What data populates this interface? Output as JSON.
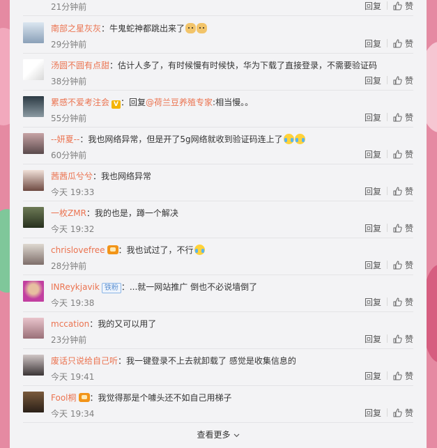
{
  "top_row": {
    "time": "21分钟前",
    "reply": "回复",
    "like": "赞"
  },
  "comments": [
    {
      "user": "南部之星灰灰",
      "text": "：牛鬼蛇神都跳出来了",
      "emojis": [
        "dog",
        "dog"
      ],
      "time": "29分钟前",
      "badge": "",
      "reply": "回复",
      "like": "赞"
    },
    {
      "user": "汤圆不圆有点甜",
      "text": "：估计人多了，有时候慢有时候快，华为下载了直接登录，不需要验证码",
      "emojis": [],
      "time": "38分钟前",
      "badge": "",
      "reply": "回复",
      "like": "赞"
    },
    {
      "user": "累感不爱考注会",
      "text_pre": "：回复",
      "mention": "@荷兰豆养殖专家",
      "text": ":相当慢。。",
      "emojis": [],
      "time": "55分钟前",
      "badge": "v",
      "reply": "回复",
      "like": "赞"
    },
    {
      "user": "--妍夏--",
      "text": "：我也网络异常，但是开了5g网络就收到验证码连上了",
      "emojis": [
        "tears",
        "tears"
      ],
      "time": "60分钟前",
      "badge": "",
      "reply": "回复",
      "like": "赞"
    },
    {
      "user": "茜茜瓜兮兮",
      "text": "：我也网络异常",
      "emojis": [],
      "time": "今天 19:33",
      "badge": "",
      "reply": "回复",
      "like": "赞"
    },
    {
      "user": "一枚ZMR",
      "text": "：我的也是，蹲一个解决",
      "emojis": [],
      "time": "今天 19:32",
      "badge": "",
      "reply": "回复",
      "like": "赞"
    },
    {
      "user": "chrislovefree",
      "text": "：我也试过了，不行",
      "emojis": [
        "tears"
      ],
      "time": "28分钟前",
      "badge": "vip",
      "reply": "回复",
      "like": "赞"
    },
    {
      "user": "INReykjavik",
      "text": "：...就一网站推广 倒也不必说墙倒了",
      "emojis": [],
      "time": "今天 19:38",
      "badge": "fan",
      "badge_text": "铁粉",
      "reply": "回复",
      "like": "赞"
    },
    {
      "user": "mccation",
      "text": "：我的又可以用了",
      "emojis": [],
      "time": "23分钟前",
      "badge": "",
      "reply": "回复",
      "like": "赞"
    },
    {
      "user": "废话只说给自己听",
      "text": "：我一键登录不上去就卸载了 感觉是收集信息的",
      "emojis": [],
      "time": "今天 19:41",
      "badge": "",
      "reply": "回复",
      "like": "赞"
    },
    {
      "user": "Fool桐",
      "text": "：我觉得那是个噱头还不如自己用梯子",
      "emojis": [],
      "time": "今天 19:34",
      "badge": "vip",
      "reply": "回复",
      "like": "赞"
    }
  ],
  "see_more": "查看更多",
  "colors": {
    "username": "#eb7350",
    "background": "#f3f3f5",
    "page_bg": "#e58aa2"
  }
}
